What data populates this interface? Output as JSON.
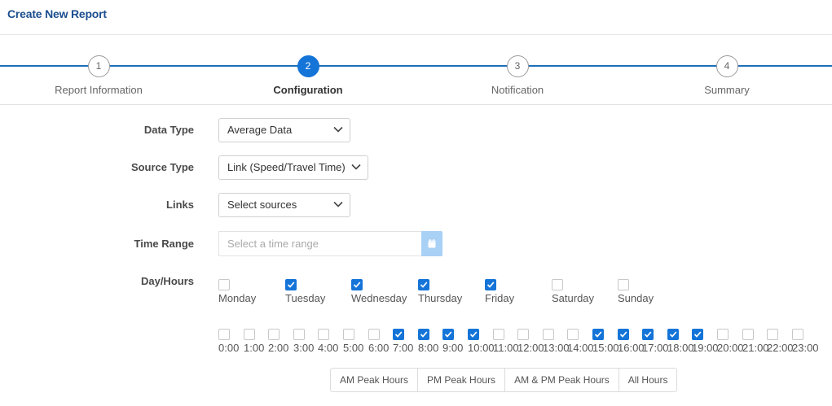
{
  "header": {
    "title": "Create New Report"
  },
  "steps": [
    {
      "number": "1",
      "label": "Report Information"
    },
    {
      "number": "2",
      "label": "Configuration",
      "active": true
    },
    {
      "number": "3",
      "label": "Notification"
    },
    {
      "number": "4",
      "label": "Summary"
    }
  ],
  "form": {
    "data_type": {
      "label": "Data Type",
      "value": "Average Data"
    },
    "source_type": {
      "label": "Source Type",
      "value": "Link (Speed/Travel Time)"
    },
    "links": {
      "label": "Links",
      "value": "Select sources"
    },
    "time_range": {
      "label": "Time Range",
      "placeholder": "Select a time range"
    },
    "day_hours": {
      "label": "Day/Hours"
    }
  },
  "days": [
    {
      "label": "Monday",
      "checked": false
    },
    {
      "label": "Tuesday",
      "checked": true
    },
    {
      "label": "Wednesday",
      "checked": true
    },
    {
      "label": "Thursday",
      "checked": true
    },
    {
      "label": "Friday",
      "checked": true
    },
    {
      "label": "Saturday",
      "checked": false
    },
    {
      "label": "Sunday",
      "checked": false
    }
  ],
  "hours": [
    {
      "label": "0:00",
      "checked": false
    },
    {
      "label": "1:00",
      "checked": false
    },
    {
      "label": "2:00",
      "checked": false
    },
    {
      "label": "3:00",
      "checked": false
    },
    {
      "label": "4:00",
      "checked": false
    },
    {
      "label": "5:00",
      "checked": false
    },
    {
      "label": "6:00",
      "checked": false
    },
    {
      "label": "7:00",
      "checked": true
    },
    {
      "label": "8:00",
      "checked": true
    },
    {
      "label": "9:00",
      "checked": true
    },
    {
      "label": "10:00",
      "checked": true
    },
    {
      "label": "11:00",
      "checked": false
    },
    {
      "label": "12:00",
      "checked": false
    },
    {
      "label": "13:00",
      "checked": false
    },
    {
      "label": "14:00",
      "checked": false
    },
    {
      "label": "15:00",
      "checked": true
    },
    {
      "label": "16:00",
      "checked": true
    },
    {
      "label": "17:00",
      "checked": true
    },
    {
      "label": "18:00",
      "checked": true
    },
    {
      "label": "19:00",
      "checked": true
    },
    {
      "label": "20:00",
      "checked": false
    },
    {
      "label": "21:00",
      "checked": false
    },
    {
      "label": "22:00",
      "checked": false
    },
    {
      "label": "23:00",
      "checked": false
    }
  ],
  "presets": {
    "am_peak": "AM Peak Hours",
    "pm_peak": "PM Peak Hours",
    "am_pm_peak": "AM & PM Peak Hours",
    "all_hours": "All Hours"
  },
  "colors": {
    "title": "#1c4f8f",
    "accent": "#1474d8",
    "step_line": "#1c6fb8",
    "calendar_button": "#a9d0f5"
  },
  "icons": {
    "select_arrow": "chevron-down-icon",
    "calendar": "calendar-icon",
    "checkbox_check": "check-icon"
  }
}
